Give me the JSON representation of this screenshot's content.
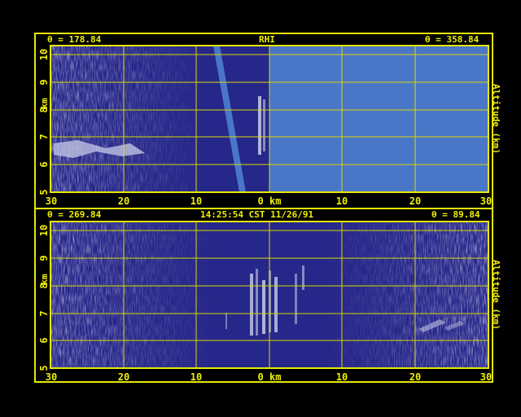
{
  "colors": {
    "background": "#000000",
    "frame": "#e8e800",
    "text": "#f0f000",
    "plot_bg": "#26278a",
    "no_data": "#4a76c8",
    "grid": "#d8d800",
    "echo": "#c8cce8"
  },
  "top_panel": {
    "left_angle": "θ = 178.84",
    "center_label": "RHI",
    "right_angle": "θ = 358.84",
    "y_label_left": "km",
    "y_label_right": "Altitude (km)",
    "x_ticks": [
      "30",
      "20",
      "10",
      "0 km",
      "10",
      "20",
      "30"
    ],
    "y_ticks": [
      "5",
      "6",
      "7",
      "8",
      "9",
      "10"
    ]
  },
  "bottom_panel": {
    "left_angle": "θ = 269.84",
    "center_label": "14:25:54 CST 11/26/91",
    "right_angle": "θ = 89.84",
    "y_label_left": "km",
    "y_label_right": "Altitude (km)",
    "x_ticks": [
      "30",
      "20",
      "10",
      "0 km",
      "10",
      "20",
      "30"
    ],
    "y_ticks": [
      "5",
      "6",
      "7",
      "8",
      "9",
      "10"
    ]
  }
}
